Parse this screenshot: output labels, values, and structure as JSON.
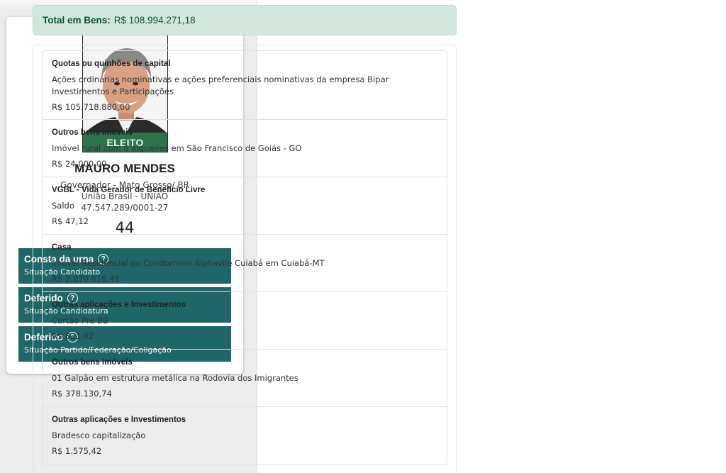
{
  "candidate": {
    "badge": "ELEITO",
    "name": "MAURO MENDES",
    "office": "Governador - Mato Grosso/ BR",
    "party": "União Brasil - UNIÃO",
    "cnpj": "47.547.289/0001-27",
    "number": "44"
  },
  "status": [
    {
      "title": "Consta da urna",
      "subtitle": "Situação Candidato"
    },
    {
      "title": "Deferido",
      "subtitle": "Situação Candidatura"
    },
    {
      "title": "Deferido",
      "subtitle": "Situação Partido/Federação/Coligação"
    }
  ],
  "total": {
    "label": "Total em Bens:",
    "value": "R$ 108.994.271,18"
  },
  "assets": [
    {
      "type": "Quotas ou quinhões de capital",
      "description": "Ações ordinárias nominativas e ações preferenciais nominativas da empresa Bipar Investimentos e Participações",
      "value": "R$ 105.718.880,00"
    },
    {
      "type": "Outros bens imóveis",
      "description": "Imóvel rural com 8 alqueires em São Francisco de Goiás - GO",
      "value": "R$ 24.000,00"
    },
    {
      "type": "VGBL - Vida Gerador de Benefício Livre",
      "description": "Saldo",
      "value": "R$ 47,12"
    },
    {
      "type": "Casa",
      "description": "Imóvel Residencial no Condomínio Alphavile Cuiabá em Cuiabá-MT",
      "value": "R$ 2.870.816,48"
    },
    {
      "type": "Outras aplicações e Investimentos",
      "description": "Cartão Pre BB",
      "value": "R$ 821,42"
    },
    {
      "type": "Outros bens imóveis",
      "description": "01 Galpão em estrutura metálica na Rodovia dos Imigrantes",
      "value": "R$ 378.130,74"
    },
    {
      "type": "Outras aplicações e Investimentos",
      "description": "Bradesco capitalização",
      "value": "R$ 1.575,42"
    }
  ],
  "icons": {
    "help": "question-circle-icon"
  },
  "colors": {
    "status_bg": "#1e6668",
    "badge_bg": "#2e7a4e",
    "total_bg": "#d1e7dd",
    "total_text": "#0f5132"
  }
}
